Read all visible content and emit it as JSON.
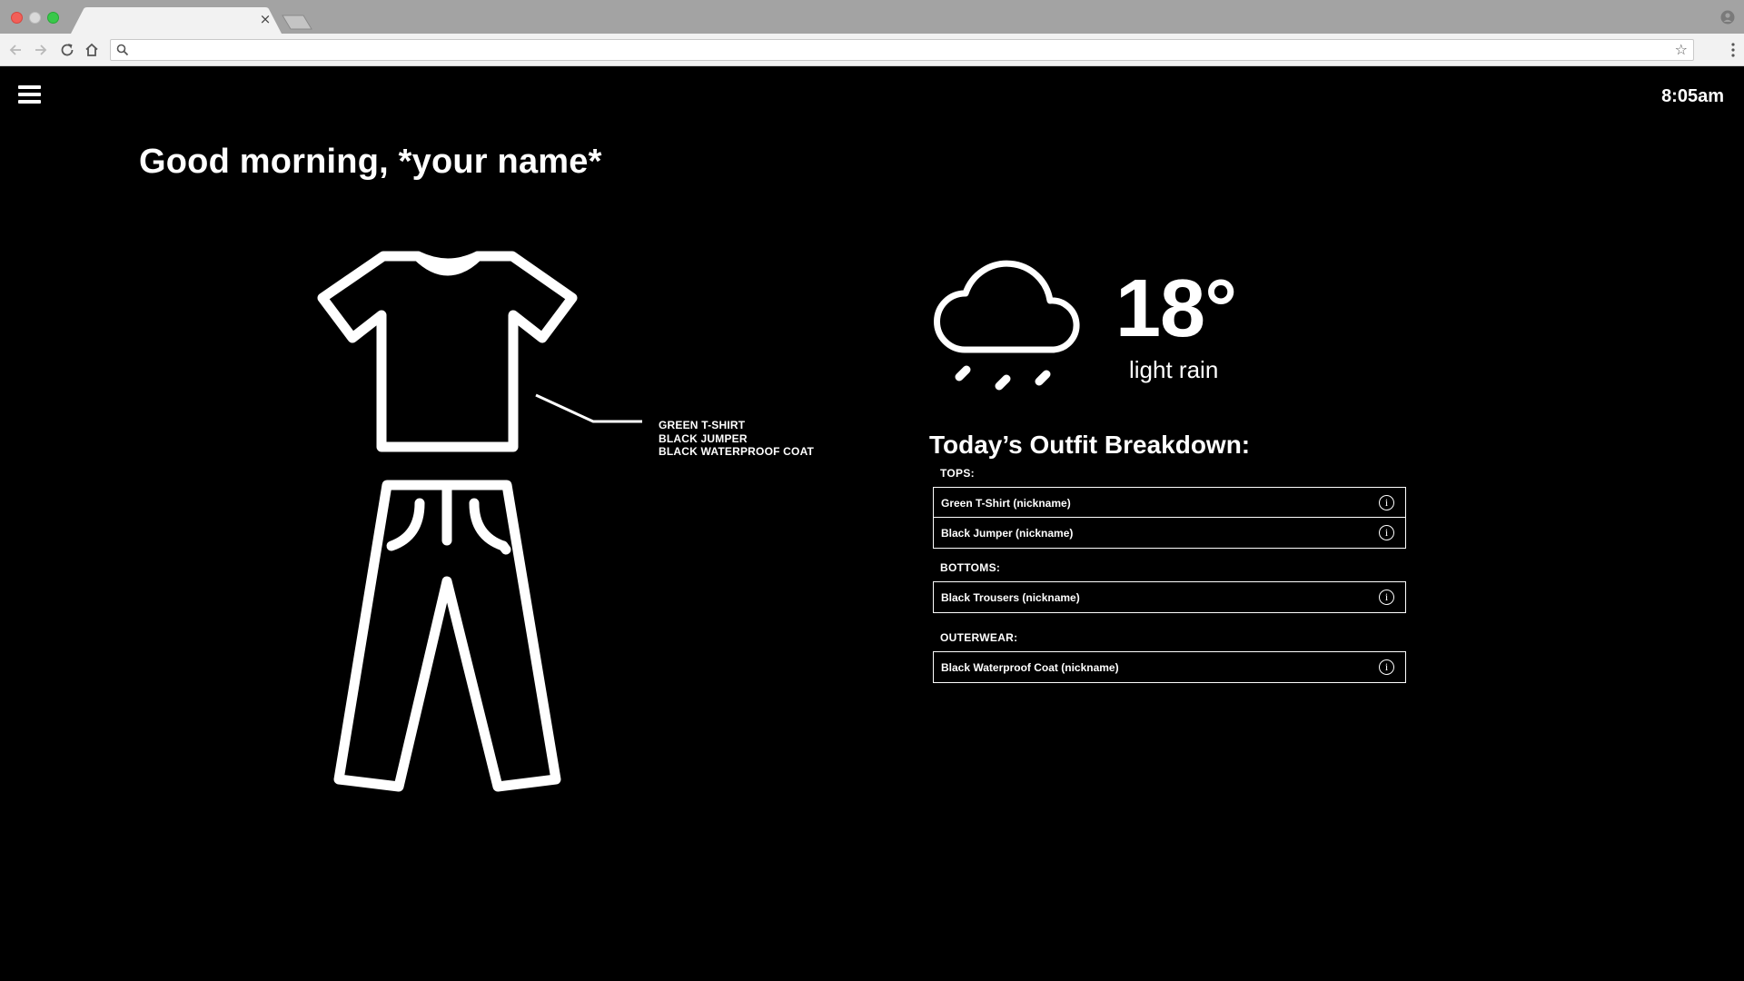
{
  "browser": {
    "tab_close": "×",
    "address_value": "",
    "star_glyph": "☆"
  },
  "header": {
    "time": "8:05am"
  },
  "greeting": "Good morning, *your name*",
  "outfit": {
    "labels": [
      "GREEN T-SHIRT",
      "BLACK JUMPER",
      "BLACK WATERPROOF COAT"
    ]
  },
  "weather": {
    "temperature": "18°",
    "condition": "light rain",
    "icon": "cloud-rain-icon"
  },
  "breakdown": {
    "title": "Today’s Outfit Breakdown:",
    "groups": [
      {
        "label": "TOPS:",
        "items": [
          "Green T-Shirt (nickname)",
          "Black Jumper (nickname)"
        ]
      },
      {
        "label": "BOTTOMS:",
        "items": [
          "Black Trousers (nickname)"
        ]
      },
      {
        "label": "OUTERWEAR:",
        "items": [
          "Black Waterproof Coat (nickname)"
        ]
      }
    ],
    "info_glyph": "i"
  },
  "colors": {
    "background": "#000000",
    "foreground": "#ffffff",
    "chrome": "#a3a3a3"
  }
}
